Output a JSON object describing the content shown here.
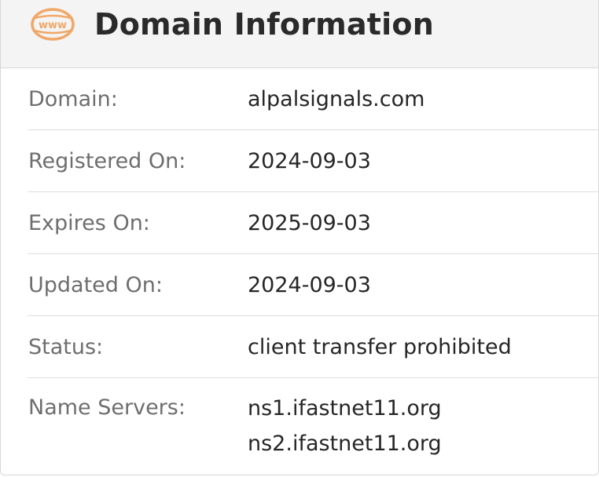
{
  "header": {
    "icon": "www-icon",
    "icon_text": "www",
    "title": "Domain Information",
    "accent_color": "#f0a868"
  },
  "details": {
    "domain": {
      "label": "Domain:",
      "value": "alpalsignals.com"
    },
    "registered_on": {
      "label": "Registered On:",
      "value": "2024-09-03"
    },
    "expires_on": {
      "label": "Expires On:",
      "value": "2025-09-03"
    },
    "updated_on": {
      "label": "Updated On:",
      "value": "2024-09-03"
    },
    "status": {
      "label": "Status:",
      "value": "client transfer prohibited"
    },
    "name_servers": {
      "label": "Name Servers:",
      "values": [
        "ns1.ifastnet11.org",
        "ns2.ifastnet11.org"
      ]
    }
  }
}
